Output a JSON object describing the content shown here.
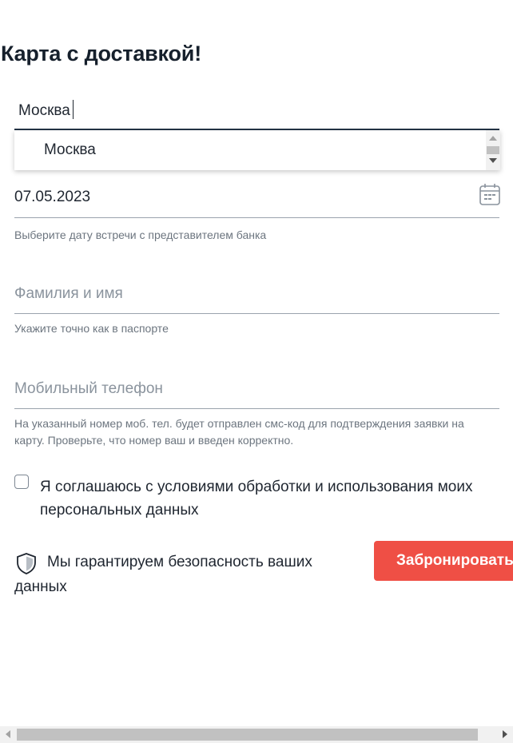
{
  "form": {
    "title": "Карта с доставкой!",
    "city": {
      "value": "Москва"
    },
    "city_dropdown": {
      "options": [
        "Москва"
      ]
    },
    "date": {
      "value": "07.05.2023",
      "hint": "Выберите дату встречи с представителем банка",
      "icon": "calendar-icon"
    },
    "name": {
      "placeholder": "Фамилия и имя",
      "hint": "Укажите точно как в паспорте"
    },
    "phone": {
      "placeholder": "Мобильный телефон",
      "hint": "На указанный номер моб. тел. будет отправлен смс-код для подтверждения заявки на карту. Проверьте, что номер ваш и введен корректно."
    },
    "consent": {
      "checked": false,
      "label": "Я соглашаюсь с условиями обработки и использования моих персональных данных"
    },
    "security": {
      "icon": "shield-icon",
      "text": "Мы гарантируем безопасность ваших данных"
    },
    "submit_label": "Забронировать"
  },
  "colors": {
    "accent": "#ef4f45",
    "text": "#1f2630",
    "hint": "#6c757f",
    "input_border_active": "#243446"
  }
}
